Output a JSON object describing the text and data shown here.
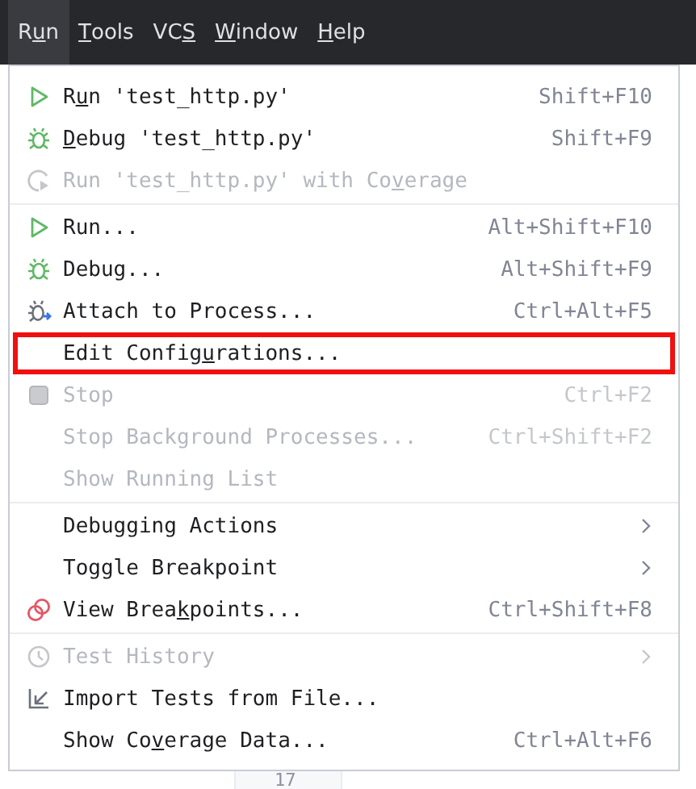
{
  "menu_bar": [
    {
      "label": {
        "before": "R",
        "key": "u",
        "after": "n"
      },
      "selected": true
    },
    {
      "label": {
        "key": "T",
        "after": "ools"
      },
      "selected": false
    },
    {
      "label": {
        "before": "VC",
        "key": "S"
      },
      "selected": false
    },
    {
      "label": {
        "key": "W",
        "after": "indow"
      },
      "selected": false
    },
    {
      "label": {
        "key": "H",
        "after": "elp"
      },
      "selected": false
    }
  ],
  "editor": {
    "line_number": "17"
  },
  "menu": {
    "groups": [
      [
        {
          "kind": "run",
          "label": {
            "before": "R",
            "key": "u",
            "after": "n 'test_http.py'"
          },
          "shortcut": "Shift+F10",
          "disabled": false
        },
        {
          "kind": "debug",
          "label": {
            "key": "D",
            "after": "ebug 'test_http.py'"
          },
          "shortcut": "Shift+F9",
          "disabled": false
        },
        {
          "kind": "coverage",
          "label": {
            "before": "Run 'test_http.py' with Co",
            "key": "v",
            "after": "erage"
          },
          "disabled": true
        }
      ],
      [
        {
          "kind": "run",
          "label": {
            "before": "Run..."
          },
          "shortcut": "Alt+Shift+F10",
          "disabled": false
        },
        {
          "kind": "debug",
          "label": {
            "before": "Debug..."
          },
          "shortcut": "Alt+Shift+F9",
          "disabled": false
        },
        {
          "kind": "attach",
          "label": {
            "before": "Attach to Process..."
          },
          "shortcut": "Ctrl+Alt+F5",
          "disabled": false
        },
        {
          "label": {
            "before": "Edit Config",
            "key": "u",
            "after": "rations..."
          },
          "disabled": false,
          "outlined": true
        },
        {
          "kind": "stop",
          "label": {
            "before": "Stop"
          },
          "shortcut": "Ctrl+F2",
          "disabled": true
        },
        {
          "label": {
            "before": "Stop Background Processes..."
          },
          "shortcut": "Ctrl+Shift+F2",
          "disabled": true
        },
        {
          "label": {
            "before": "Show Running List"
          },
          "disabled": true
        }
      ],
      [
        {
          "label": {
            "before": "Debugging Actions"
          },
          "submenu": true,
          "disabled": false
        },
        {
          "label": {
            "before": "Toggle Breakpoint"
          },
          "submenu": true,
          "disabled": false
        },
        {
          "kind": "breakpoints",
          "label": {
            "before": "View Brea",
            "key": "k",
            "after": "points..."
          },
          "shortcut": "Ctrl+Shift+F8",
          "disabled": false
        }
      ],
      [
        {
          "kind": "history",
          "label": {
            "before": "Test History"
          },
          "submenu": true,
          "disabled": true
        },
        {
          "kind": "import",
          "label": {
            "before": "Import Tests from File..."
          },
          "disabled": false
        },
        {
          "label": {
            "before": "Show Co",
            "key": "v",
            "after": "erage Data..."
          },
          "shortcut": "Ctrl+Alt+F6",
          "disabled": false
        }
      ]
    ]
  }
}
